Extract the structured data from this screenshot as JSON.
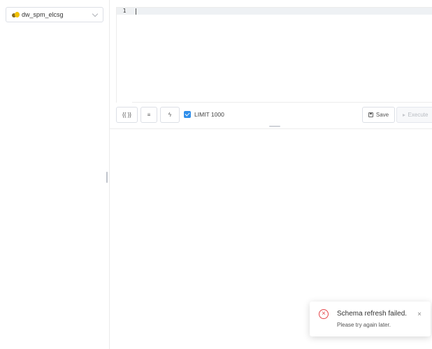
{
  "sidebar": {
    "database": {
      "selected": "dw_spm_elcsg",
      "icon": "database-icon"
    }
  },
  "editor": {
    "line_numbers": [
      "1"
    ],
    "content": ""
  },
  "toolbar": {
    "format_label": "{{ }}",
    "indent_label": "≡",
    "bolt_label": "ϟ",
    "limit_label": "LIMIT 1000",
    "limit_checked": true,
    "save_label": "Save",
    "execute_label": "Execute",
    "accent": "#2f8eea"
  },
  "notification": {
    "title": "Schema refresh failed.",
    "message": "Please try again later.",
    "close_label": "×",
    "error_icon_label": "×",
    "error_color": "#e5484d"
  }
}
